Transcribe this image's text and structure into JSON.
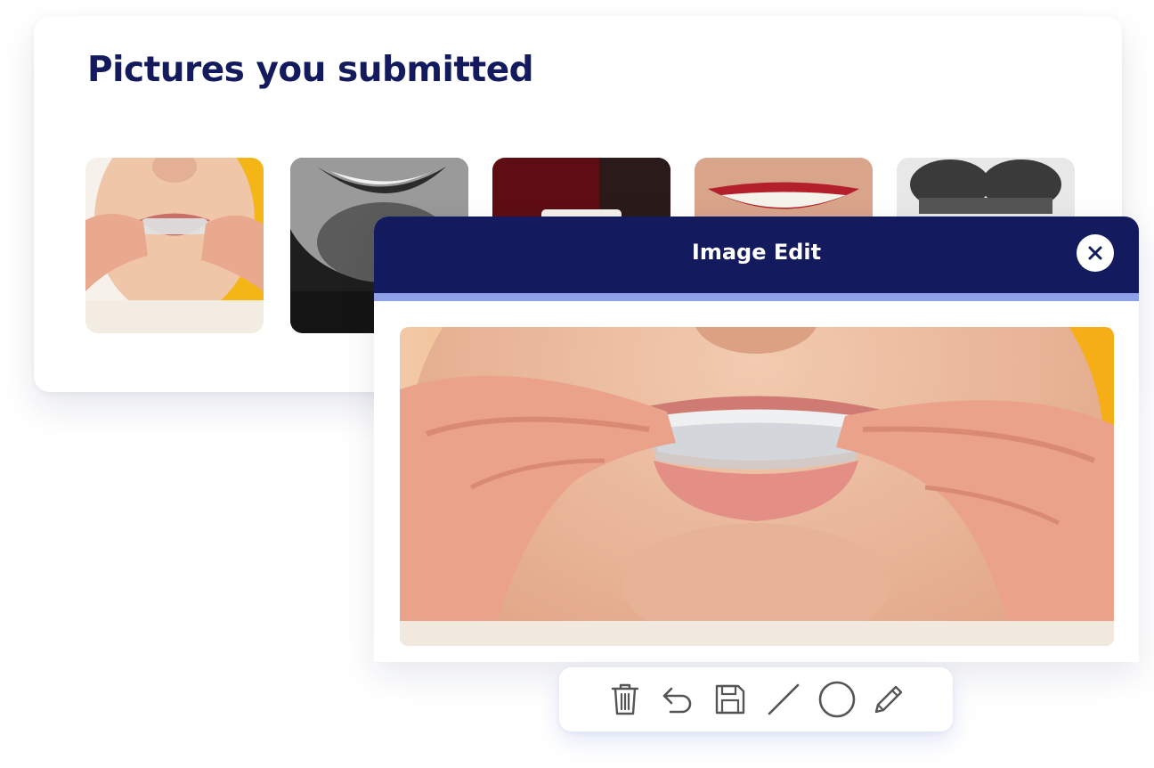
{
  "gallery": {
    "title": "Pictures you submitted",
    "thumbnails": [
      {
        "subject": "clear aligner held at mouth",
        "bg": "#f4b616"
      },
      {
        "subject": "black and white smile",
        "bg": "#2a2a2a"
      },
      {
        "subject": "smile on dark red background",
        "bg": "#5e0e12"
      },
      {
        "subject": "smile with red lips",
        "bg": "#d8a48a"
      },
      {
        "subject": "dental x-ray",
        "bg": "#e6e6e6"
      }
    ]
  },
  "modal": {
    "title": "Image Edit",
    "header_color": "#141a5e",
    "accent_color": "#8ea0e8"
  },
  "toolbar": {
    "tools": [
      {
        "name": "delete",
        "icon": "trash-icon"
      },
      {
        "name": "undo",
        "icon": "undo-icon"
      },
      {
        "name": "save",
        "icon": "save-icon"
      },
      {
        "name": "line",
        "icon": "line-icon"
      },
      {
        "name": "circle",
        "icon": "circle-icon"
      },
      {
        "name": "pencil",
        "icon": "pencil-icon"
      }
    ]
  },
  "colors": {
    "navy": "#141a5e",
    "accent": "#8ea0e8",
    "icon": "#555555"
  }
}
